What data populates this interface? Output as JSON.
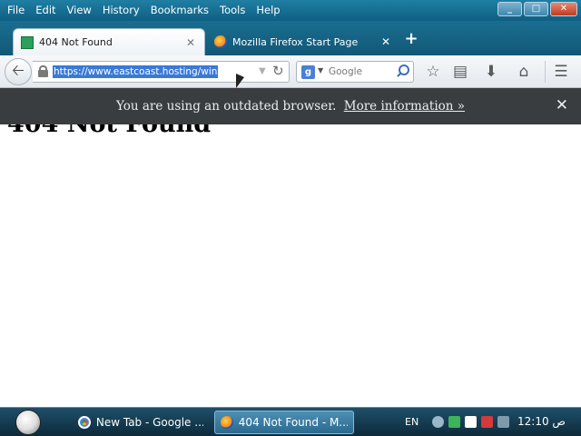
{
  "menu": [
    "File",
    "Edit",
    "View",
    "History",
    "Bookmarks",
    "Tools",
    "Help"
  ],
  "window_controls": {
    "minimize": "_",
    "restore": "□",
    "close": "✕"
  },
  "tabs": [
    {
      "title": "404 Not Found",
      "active": true,
      "icon": "page-icon"
    },
    {
      "title": "Mozilla Firefox Start Page",
      "active": false,
      "icon": "firefox-icon"
    }
  ],
  "new_tab_label": "+",
  "navbar": {
    "back_glyph": "🡠",
    "url": "https://www.eastcoast.hosting/win",
    "search_placeholder": "Google",
    "search_engine_letter": "g"
  },
  "notification": {
    "message": "You are using an outdated browser.",
    "link": "More information »",
    "close": "✕"
  },
  "page": {
    "heading": "404 Not Found"
  },
  "taskbar": {
    "items": [
      {
        "label": "New Tab - Google ...",
        "icon": "chrome-icon",
        "active": false
      },
      {
        "label": "404 Not Found - M...",
        "icon": "firefox-icon",
        "active": true
      }
    ],
    "language": "EN",
    "clock": "12:10 ص"
  },
  "colors": {
    "titlebar": "#1f7fa3",
    "notification_bg": "#3a3d40",
    "url_selection": "#3a79d6",
    "taskbar": "#1e4f6a"
  }
}
